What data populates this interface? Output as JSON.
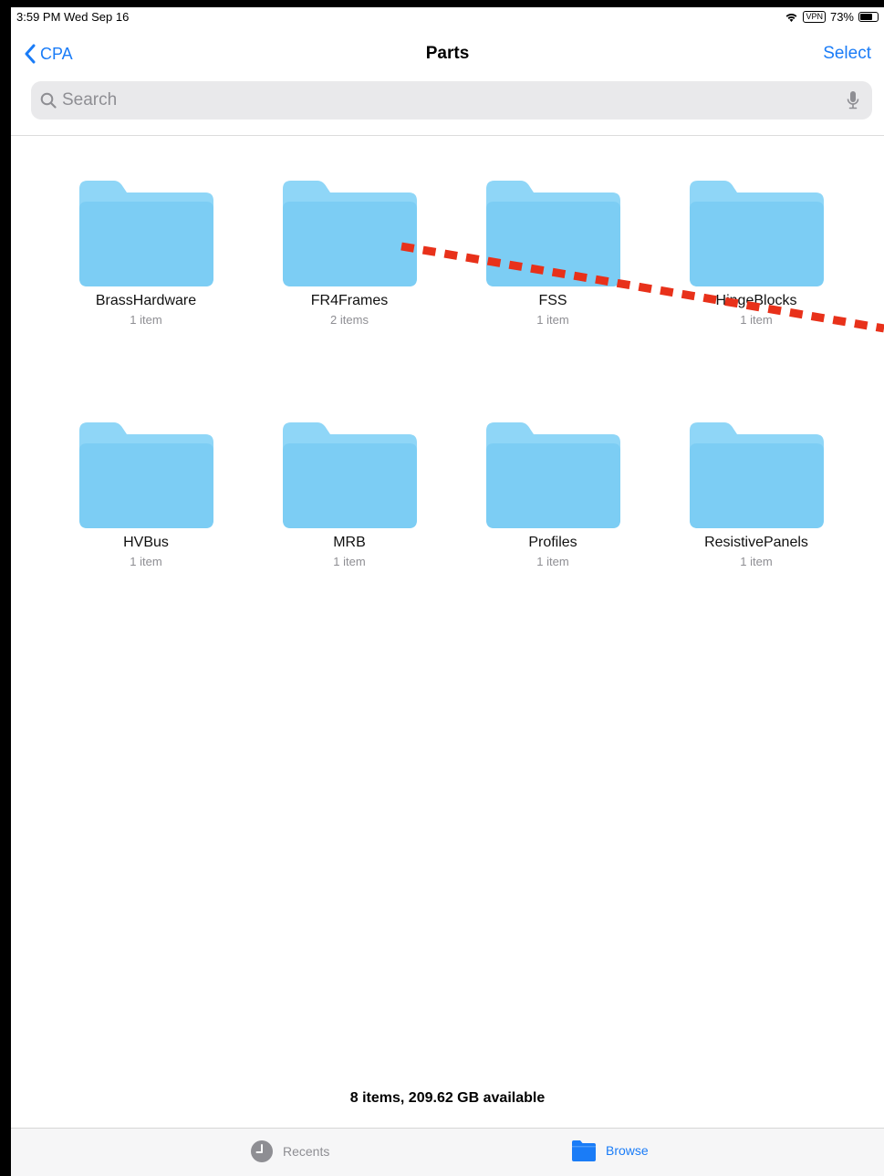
{
  "status_bar": {
    "time_date": "3:59 PM  Wed Sep 16",
    "vpn": "VPN",
    "battery": "73%",
    "battery_level": 0.73
  },
  "nav": {
    "back_label": "CPA",
    "title": "Parts",
    "select_label": "Select"
  },
  "search": {
    "placeholder": "Search"
  },
  "folders": [
    {
      "name": "BrassHardware",
      "count": "1 item"
    },
    {
      "name": "FR4Frames",
      "count": "2 items"
    },
    {
      "name": "FSS",
      "count": "1 item"
    },
    {
      "name": "HingeBlocks",
      "count": "1 item"
    },
    {
      "name": "HVBus",
      "count": "1 item"
    },
    {
      "name": "MRB",
      "count": "1 item"
    },
    {
      "name": "Profiles",
      "count": "1 item"
    },
    {
      "name": "ResistivePanels",
      "count": "1 item"
    }
  ],
  "footer": {
    "summary": "8 items, 209.62 GB available"
  },
  "tab_bar": {
    "recents_label": "Recents",
    "browse_label": "Browse"
  },
  "colors": {
    "accent": "#1a7cf7",
    "folder_light": "#8fd6f7",
    "folder_dark": "#7ccdf4",
    "annotation": "#e8311a"
  }
}
